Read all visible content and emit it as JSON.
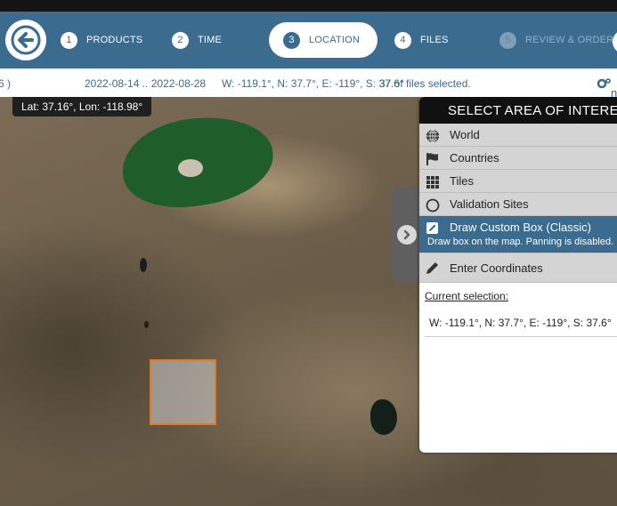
{
  "steps": [
    {
      "num": "1",
      "label": "PRODUCTS"
    },
    {
      "num": "2",
      "label": "TIME"
    },
    {
      "num": "3",
      "label": "LOCATION"
    },
    {
      "num": "4",
      "label": "FILES"
    },
    {
      "num": "5",
      "label": "REVIEW & ORDER"
    }
  ],
  "active_step": "LOCATION",
  "infobar": {
    "left_fragment": "6 )",
    "date_range": "2022-08-14 .. 2022-08-28",
    "bbox": "W: -119.1°, N: 37.7°, E: -119°, S: 37.6°",
    "files_selected": "37 of files selected.",
    "gear_label": "n"
  },
  "map": {
    "coord_readout": "Lat: 37.16°, Lon: -118.98°"
  },
  "panel": {
    "title": "SELECT AREA OF INTEREST",
    "options": [
      {
        "label": "World",
        "icon": "globe-icon"
      },
      {
        "label": "Countries",
        "icon": "flag-icon"
      },
      {
        "label": "Tiles",
        "icon": "grid-icon"
      },
      {
        "label": "Validation Sites",
        "icon": "circle-icon"
      },
      {
        "label": "Draw Custom Box (Classic)",
        "sub": "Draw box on the map. Panning is disabled.",
        "icon": "edit-box-icon",
        "selected": true
      },
      {
        "label": "Enter Coordinates",
        "icon": "pencil-icon"
      }
    ],
    "current_selection_label": "Current selection:",
    "current_selection_value": "W: -119.1°, N: 37.7°, E: -119°, S: 37.6°"
  },
  "colors": {
    "accent": "#3b6b8f",
    "selection_border": "#e07a2a",
    "lake": "#1f5d2a"
  }
}
